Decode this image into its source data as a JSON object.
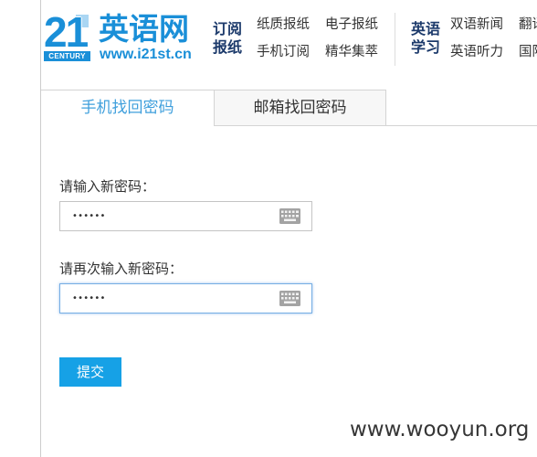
{
  "logo": {
    "mark_number": "21",
    "mark_word": "CENTURY",
    "site_name": "英语网",
    "site_url": "www.i21st.cn"
  },
  "nav": {
    "subscribe": {
      "title": [
        "订阅",
        "报纸"
      ],
      "links": [
        "纸质报纸",
        "电子报纸",
        "手机订阅",
        "精华集萃"
      ]
    },
    "learning": {
      "title": [
        "英语",
        "学习"
      ],
      "links": [
        "双语新闻",
        "翻译",
        "英语听力",
        "国际"
      ]
    }
  },
  "tabs": [
    {
      "label": "手机找回密码",
      "active": true
    },
    {
      "label": "邮箱找回密码",
      "active": false
    }
  ],
  "form": {
    "new_password": {
      "label": "请输入新密码：",
      "value": "••••••",
      "icon": "keyboard-icon",
      "focused": false
    },
    "confirm_password": {
      "label": "请再次输入新密码：",
      "value": "••••••",
      "icon": "keyboard-icon",
      "focused": true
    },
    "submit": {
      "label": "提交"
    }
  },
  "watermark": "www.wooyun.org",
  "colors": {
    "brand_blue": "#1a8fd8",
    "nav_title": "#1c3a6b",
    "tab_active_text": "#3f9fdc",
    "tab_inactive_bg": "#f7f7f7",
    "focus_border": "#75ade4",
    "submit_bg": "#16a1e6"
  }
}
